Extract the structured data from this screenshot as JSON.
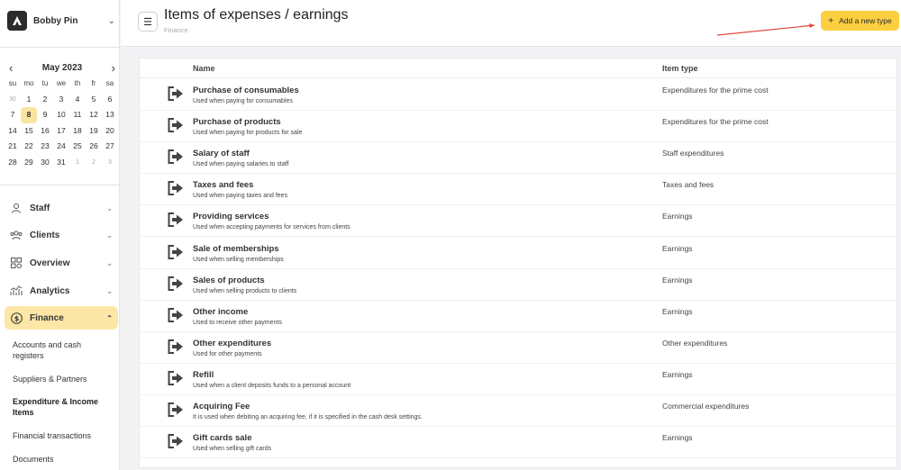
{
  "user": {
    "name": "Bobby Pin"
  },
  "calendar": {
    "month_label": "May 2023",
    "weekdays": [
      "su",
      "mo",
      "tu",
      "we",
      "th",
      "fr",
      "sa"
    ],
    "weeks": [
      [
        "30",
        "1",
        "2",
        "3",
        "4",
        "5",
        "6"
      ],
      [
        "7",
        "8",
        "9",
        "10",
        "11",
        "12",
        "13"
      ],
      [
        "14",
        "15",
        "16",
        "17",
        "18",
        "19",
        "20"
      ],
      [
        "21",
        "22",
        "23",
        "24",
        "25",
        "26",
        "27"
      ],
      [
        "28",
        "29",
        "30",
        "31",
        "1",
        "2",
        "3"
      ]
    ],
    "selected_day": "8"
  },
  "nav": {
    "staff": "Staff",
    "clients": "Clients",
    "overview": "Overview",
    "analytics": "Analytics",
    "finance": "Finance",
    "finance_sub": {
      "accounts": "Accounts and cash registers",
      "suppliers": "Suppliers & Partners",
      "expenditure": "Expenditure & Income Items",
      "transactions": "Financial transactions",
      "documents": "Documents"
    }
  },
  "header": {
    "title": "Items of expenses / earnings",
    "breadcrumb": "Finance",
    "add_button": "Add a new type"
  },
  "table": {
    "col_name": "Name",
    "col_type": "Item type",
    "rows": [
      {
        "name": "Purchase of consumables",
        "desc": "Used when paying for consumables",
        "type": "Expenditures for the prime cost"
      },
      {
        "name": "Purchase of products",
        "desc": "Used when paying for products for sale",
        "type": "Expenditures for the prime cost"
      },
      {
        "name": "Salary of staff",
        "desc": "Used when paying salaries to staff",
        "type": "Staff expenditures"
      },
      {
        "name": "Taxes and fees",
        "desc": "Used when paying taxes and fees",
        "type": "Taxes and fees"
      },
      {
        "name": "Providing services",
        "desc": "Used when accepting payments for services from clients",
        "type": "Earnings"
      },
      {
        "name": "Sale of memberships",
        "desc": "Used when selling memberships",
        "type": "Earnings"
      },
      {
        "name": "Sales of products",
        "desc": "Used when selling products to clients",
        "type": "Earnings"
      },
      {
        "name": "Other income",
        "desc": "Used to receive other payments",
        "type": "Earnings"
      },
      {
        "name": "Other expenditures",
        "desc": "Used for other payments",
        "type": "Other expenditures"
      },
      {
        "name": "Refill",
        "desc": "Used when a client deposits funds to a personal account",
        "type": "Earnings"
      },
      {
        "name": "Acquiring Fee",
        "desc": "It is used when debiting an acquiring fee, if it is specified in the cash desk settings.",
        "type": "Commercial expenditures"
      },
      {
        "name": "Gift cards sale",
        "desc": "Used when selling gift cards",
        "type": "Earnings"
      }
    ]
  },
  "colors": {
    "accent": "#fbcf3f",
    "active_nav": "#fde7a6",
    "annotation": "#e0453a"
  }
}
